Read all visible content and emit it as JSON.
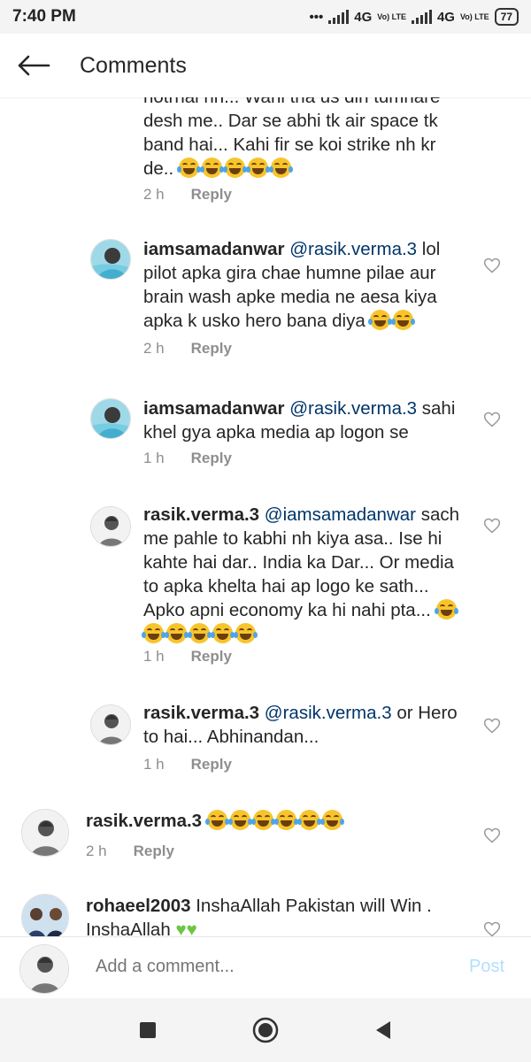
{
  "status": {
    "time": "7:40 PM",
    "net1": "4G",
    "net2": "4G",
    "volte": "Vo) LTE",
    "battery": "77"
  },
  "header": {
    "title": "Comments"
  },
  "comments": [
    {
      "user": "",
      "mention": "",
      "lines": [
        "notrnai nn... Wahi tha us din tumhare",
        "desh me.. Dar se abhi tk air space tk",
        "band hai... Kahi fir se koi strike nh kr",
        "de.."
      ],
      "emoji_count": 5,
      "time": "2 h",
      "reply": "Reply"
    },
    {
      "user": "iamsamadanwar",
      "mention": "@rasik.verma.3",
      "text": "lol pilot apka gira chae humne pilae aur brain wash apke media ne aesa kiya apka k usko hero bana diya",
      "emoji_count": 2,
      "time": "2 h",
      "reply": "Reply"
    },
    {
      "user": "iamsamadanwar",
      "mention": "@rasik.verma.3",
      "text": "sahi khel gya apka media ap logon se",
      "emoji_count": 0,
      "time": "1 h",
      "reply": "Reply"
    },
    {
      "user": "rasik.verma.3",
      "mention": "@iamsamadanwar",
      "text": "sach me pahle to kabhi nh kiya asa.. Ise hi kahte hai dar.. India ka Dar... Or media to apka khelta hai ap logo ke sath... Apko apni economy ka hi nahi pta...",
      "emoji_count": 6,
      "time": "1 h",
      "reply": "Reply"
    },
    {
      "user": "rasik.verma.3",
      "mention": "@rasik.verma.3",
      "text": "or Hero to hai... Abhinandan...",
      "emoji_count": 0,
      "time": "1 h",
      "reply": "Reply"
    },
    {
      "user": "rasik.verma.3",
      "mention": "",
      "text": "",
      "emoji_count": 6,
      "time": "2 h",
      "reply": "Reply"
    },
    {
      "user": "rohaeel2003",
      "mention": "",
      "text": "InshaAllah Pakistan will Win . InshaAllah",
      "emoji_count": 0,
      "time": "",
      "reply": ""
    }
  ],
  "add_comment": {
    "placeholder": "Add a comment...",
    "post": "Post"
  },
  "colors": {
    "mention": "#003569",
    "muted": "#8e8e8e",
    "post": "#b2dffc",
    "heart_green": "#6cc644"
  }
}
